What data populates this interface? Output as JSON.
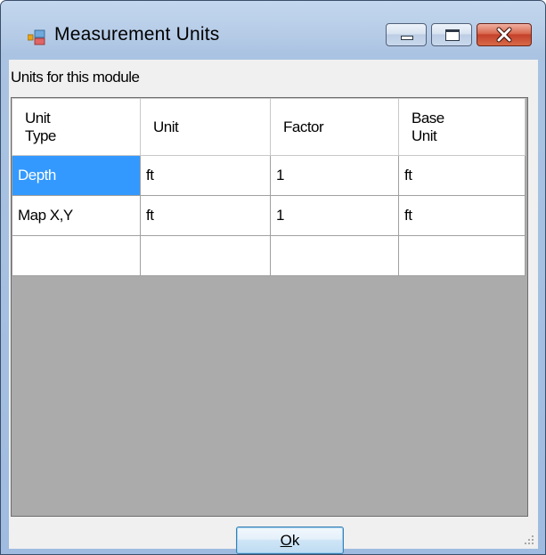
{
  "window": {
    "title": "Measurement Units",
    "controls": {
      "minimize": "minimize-icon",
      "maximize": "maximize-icon",
      "close": "close-icon"
    }
  },
  "form": {
    "module_label": "Units for this module"
  },
  "grid": {
    "columns": [
      "Unit\nType",
      "Unit",
      "Factor",
      "Base\nUnit"
    ],
    "rows": [
      {
        "unit_type": "Depth",
        "unit": "ft",
        "factor": "1",
        "base_unit": "ft"
      },
      {
        "unit_type": "Map X,Y",
        "unit": "ft",
        "factor": "1",
        "base_unit": "ft"
      },
      {
        "unit_type": "",
        "unit": "",
        "factor": "",
        "base_unit": ""
      }
    ],
    "selected_cell": {
      "row": 0,
      "column": "unit_type"
    },
    "colors": {
      "selection": "#3399ff",
      "empty_area": "#ababab"
    }
  },
  "buttons": {
    "ok": {
      "mnemonic": "O",
      "rest": "k"
    }
  }
}
